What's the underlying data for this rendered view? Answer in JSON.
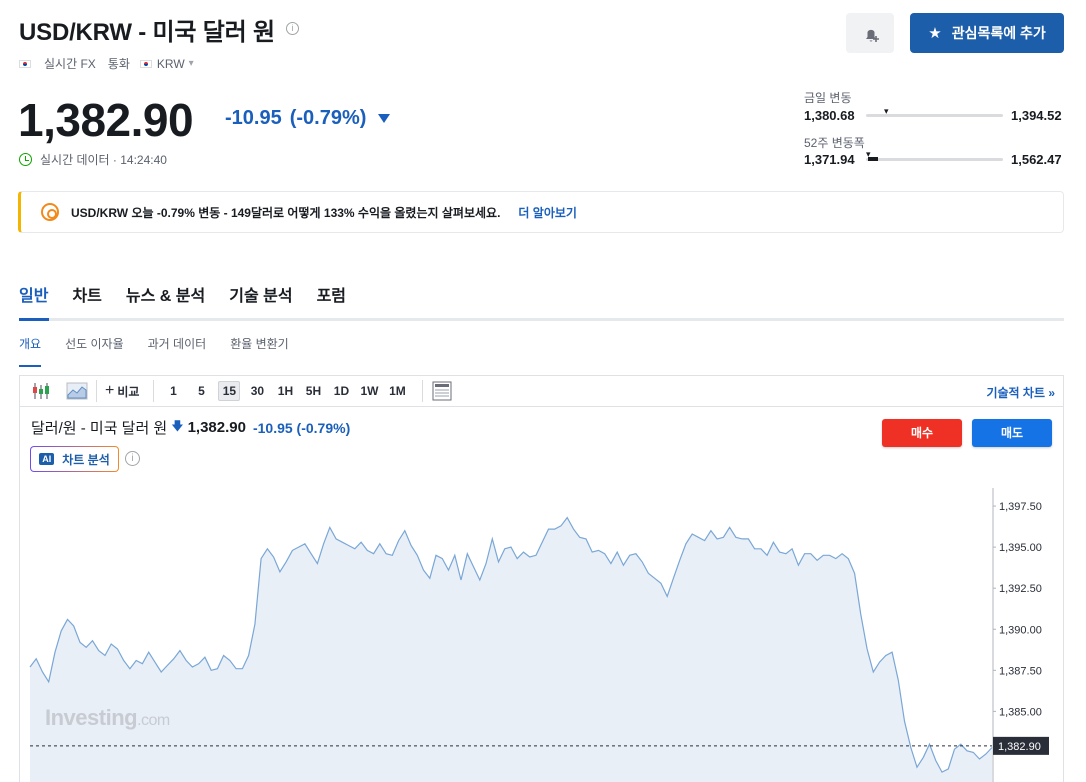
{
  "header": {
    "title": "USD/KRW - 미국 달러 원",
    "info_icon": "i",
    "meta": {
      "source": "실시간 FX",
      "type": "통화",
      "currency": "KRW",
      "currency_dropdown": "▾"
    },
    "watchlist_label": "관심목록에 추가"
  },
  "quote": {
    "price": "1,382.90",
    "change": "-10.95",
    "change_pct": "(-0.79%)",
    "realtime_label": "실시간 데이터 · 14:24:40"
  },
  "ranges": {
    "day": {
      "label": "금일 변동",
      "low": "1,380.68",
      "high": "1,394.52",
      "marker_pos": 0.15
    },
    "week52": {
      "label": "52주 변동폭",
      "low": "1,371.94",
      "high": "1,562.47",
      "marker_pos": 0.03
    }
  },
  "promo": {
    "text": "USD/KRW 오늘 -0.79% 변동 - 149달러로 어떻게 133% 수익을 올렸는지 살펴보세요.",
    "link": "더 알아보기"
  },
  "tabs": [
    "일반",
    "차트",
    "뉴스 & 분석",
    "기술 분석",
    "포럼"
  ],
  "subtabs": [
    "개요",
    "선도 이자율",
    "과거 데이터",
    "환율 변환기"
  ],
  "chart_toolbar": {
    "compare": "비교",
    "periods": [
      "1",
      "5",
      "15",
      "30",
      "1H",
      "5H",
      "1D",
      "1W",
      "1M"
    ],
    "active_period": "15",
    "tech_chart_link": "기술적 차트 »"
  },
  "chart_header": {
    "name": "달러/원 - 미국 달러 원",
    "price": "1,382.90",
    "change": "-10.95 (-0.79%)",
    "ai_badge": "AI",
    "ai_label": "차트 분석",
    "ai_info": "i",
    "buy_label": "매수",
    "sell_label": "매도"
  },
  "watermark": {
    "brand": "Investing",
    "suffix": ".com"
  },
  "colors": {
    "accent": "#1a5fbb",
    "buy": "#ee3124",
    "sell": "#1673e5",
    "line": "#7aa7d6",
    "fill": "#e8eff7"
  },
  "chart_data": {
    "type": "area",
    "ylim": [
      1380.7,
      1398.6
    ],
    "yticks": [
      "1,397.50",
      "1,395.00",
      "1,392.50",
      "1,390.00",
      "1,387.50",
      "1,385.00"
    ],
    "ytick_values": [
      1397.5,
      1395.0,
      1392.5,
      1390.0,
      1387.5,
      1385.0
    ],
    "last_price": 1382.9,
    "last_price_label": "1,382.90",
    "values": [
      1387.7,
      1388.2,
      1387.4,
      1386.8,
      1388.6,
      1389.9,
      1390.6,
      1390.2,
      1389.2,
      1388.9,
      1389.3,
      1388.7,
      1388.4,
      1389.1,
      1388.8,
      1388.1,
      1387.6,
      1388.1,
      1387.9,
      1388.6,
      1388.0,
      1387.4,
      1387.8,
      1388.2,
      1388.7,
      1388.1,
      1387.7,
      1387.9,
      1388.3,
      1387.5,
      1387.6,
      1388.4,
      1388.1,
      1387.6,
      1387.6,
      1388.4,
      1390.3,
      1394.3,
      1394.9,
      1394.4,
      1393.5,
      1394.1,
      1394.8,
      1395.0,
      1395.2,
      1394.6,
      1394.0,
      1395.2,
      1396.2,
      1395.5,
      1395.3,
      1395.1,
      1394.9,
      1395.3,
      1394.8,
      1394.6,
      1395.2,
      1394.6,
      1394.5,
      1395.4,
      1396.0,
      1395.1,
      1394.5,
      1393.6,
      1393.1,
      1394.5,
      1394.3,
      1393.6,
      1394.5,
      1393.0,
      1394.6,
      1393.8,
      1393.0,
      1394.0,
      1395.5,
      1394.1,
      1394.9,
      1395.0,
      1394.3,
      1394.7,
      1394.4,
      1394.5,
      1395.3,
      1396.1,
      1396.1,
      1396.3,
      1396.8,
      1396.1,
      1395.6,
      1395.5,
      1394.7,
      1394.8,
      1394.6,
      1394.0,
      1394.7,
      1393.9,
      1394.5,
      1394.6,
      1394.1,
      1393.4,
      1393.1,
      1392.8,
      1392.0,
      1393.1,
      1394.2,
      1395.2,
      1395.8,
      1395.6,
      1395.4,
      1396.0,
      1395.5,
      1395.6,
      1396.2,
      1395.6,
      1395.5,
      1395.5,
      1394.9,
      1394.9,
      1394.5,
      1395.3,
      1394.7,
      1394.6,
      1394.9,
      1393.9,
      1394.6,
      1394.6,
      1394.2,
      1394.5,
      1394.5,
      1394.3,
      1394.6,
      1394.3,
      1393.4,
      1390.9,
      1388.8,
      1387.4,
      1388.0,
      1388.4,
      1388.6,
      1386.9,
      1384.4,
      1382.8,
      1381.6,
      1382.2,
      1383.0,
      1382.0,
      1381.3,
      1381.5,
      1382.7,
      1383.0,
      1382.6,
      1382.5,
      1382.1,
      1382.4,
      1382.8
    ]
  }
}
